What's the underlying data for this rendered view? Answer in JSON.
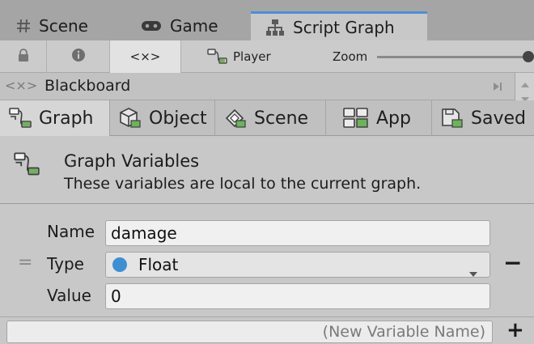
{
  "tabs": [
    {
      "label": "Scene",
      "icon": "hash-icon"
    },
    {
      "label": "Game",
      "icon": "gamepad-icon"
    },
    {
      "label": "Script Graph",
      "icon": "hierarchy-icon",
      "active": true
    }
  ],
  "toolbar": {
    "lock_icon": "lock-icon",
    "info_icon": "info-icon",
    "variables_glyph": "<×>",
    "player_label": "Player",
    "zoom_label": "Zoom",
    "zoom_level": 1.0
  },
  "blackboard": {
    "glyph": "<×>",
    "title": "Blackboard"
  },
  "scopes": [
    {
      "label": "Graph",
      "active": true
    },
    {
      "label": "Object"
    },
    {
      "label": "Scene"
    },
    {
      "label": "App"
    },
    {
      "label": "Saved"
    }
  ],
  "description": {
    "title": "Graph Variables",
    "text": "These variables are local to the current graph."
  },
  "variable": {
    "name_label": "Name",
    "name_value": "damage",
    "type_label": "Type",
    "type_value": "Float",
    "type_dot_color": "#3d8fd1",
    "value_label": "Value",
    "value_value": "0",
    "drag_glyph": "=",
    "remove_glyph": "−"
  },
  "new_variable": {
    "placeholder": "(New Variable Name)",
    "add_glyph": "+"
  }
}
